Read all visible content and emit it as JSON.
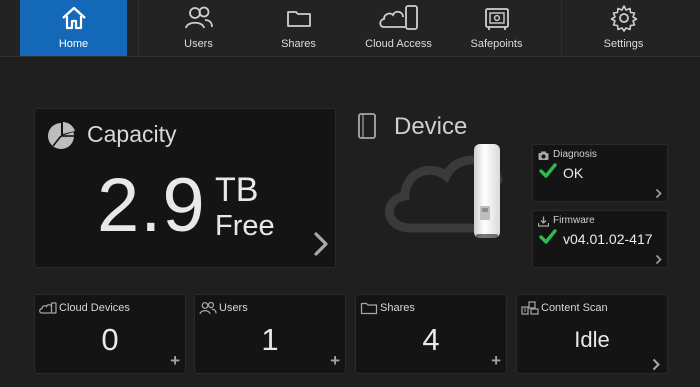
{
  "nav": {
    "items": [
      {
        "label": "Home",
        "icon": "home-icon",
        "active": true
      },
      {
        "label": "Users",
        "icon": "users-icon"
      },
      {
        "label": "Shares",
        "icon": "folder-icon"
      },
      {
        "label": "Cloud Access",
        "icon": "cloud-device-icon"
      },
      {
        "label": "Safepoints",
        "icon": "safe-icon"
      },
      {
        "label": "Settings",
        "icon": "gear-icon"
      }
    ],
    "active_color": "#1468b8"
  },
  "capacity": {
    "title": "Capacity",
    "value": "2.9",
    "unit": "TB",
    "suffix": "Free"
  },
  "device": {
    "title": "Device",
    "diagnosis": {
      "label": "Diagnosis",
      "value": "OK"
    },
    "firmware": {
      "label": "Firmware",
      "value": "v04.01.02-417"
    },
    "check_color": "#2fb84d"
  },
  "tiles": {
    "cloud_devices": {
      "label": "Cloud Devices",
      "value": "0"
    },
    "users": {
      "label": "Users",
      "value": "1"
    },
    "shares": {
      "label": "Shares",
      "value": "4"
    },
    "content_scan": {
      "label": "Content Scan",
      "value": "Idle"
    }
  }
}
